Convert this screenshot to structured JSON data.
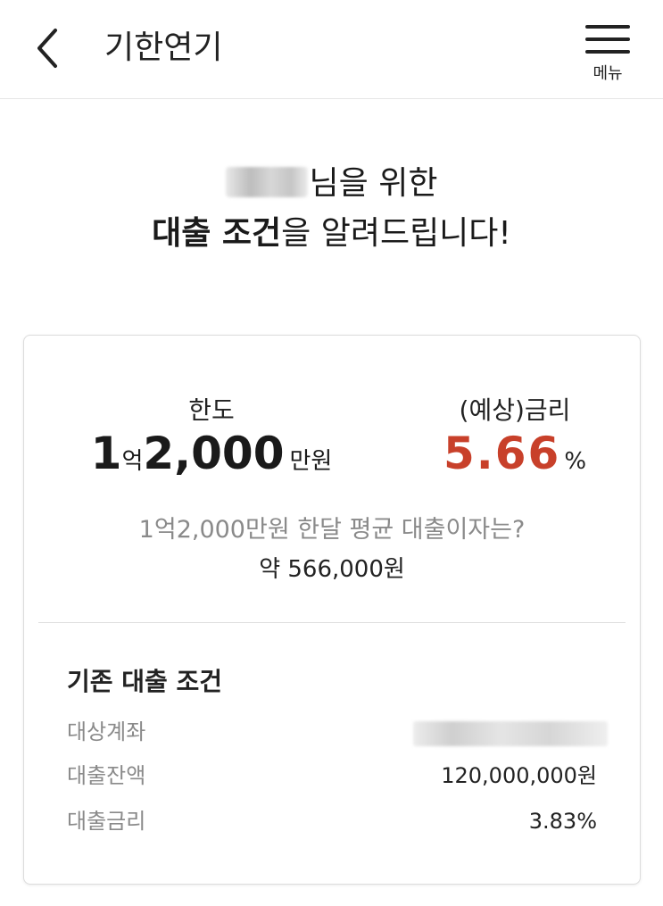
{
  "header": {
    "title": "기한연기",
    "menu_label": "메뉴",
    "back_icon": "chevron-left-icon",
    "menu_icon": "hamburger-icon"
  },
  "headline": {
    "line1_suffix": "님을 위한",
    "line2_bold": "대출 조건",
    "line2_rest": "을 알려드립니다!"
  },
  "loan_offer": {
    "limit_label": "한도",
    "limit_num1": "1",
    "limit_unit1": "억",
    "limit_num2": "2,000",
    "limit_unit2": "만원",
    "rate_label": "(예상)금리",
    "rate_value": "5.66",
    "rate_unit": "%",
    "rate_color": "#c8402a",
    "monthly_question": "1억2,000만원 한달 평균 대출이자는?",
    "monthly_answer": "약 566,000원"
  },
  "existing": {
    "title": "기존 대출 조건",
    "rows": [
      {
        "label": "대상계좌",
        "value": ""
      },
      {
        "label": "대출잔액",
        "value": "120,000,000원"
      },
      {
        "label": "대출금리",
        "value": "3.83%"
      }
    ]
  }
}
